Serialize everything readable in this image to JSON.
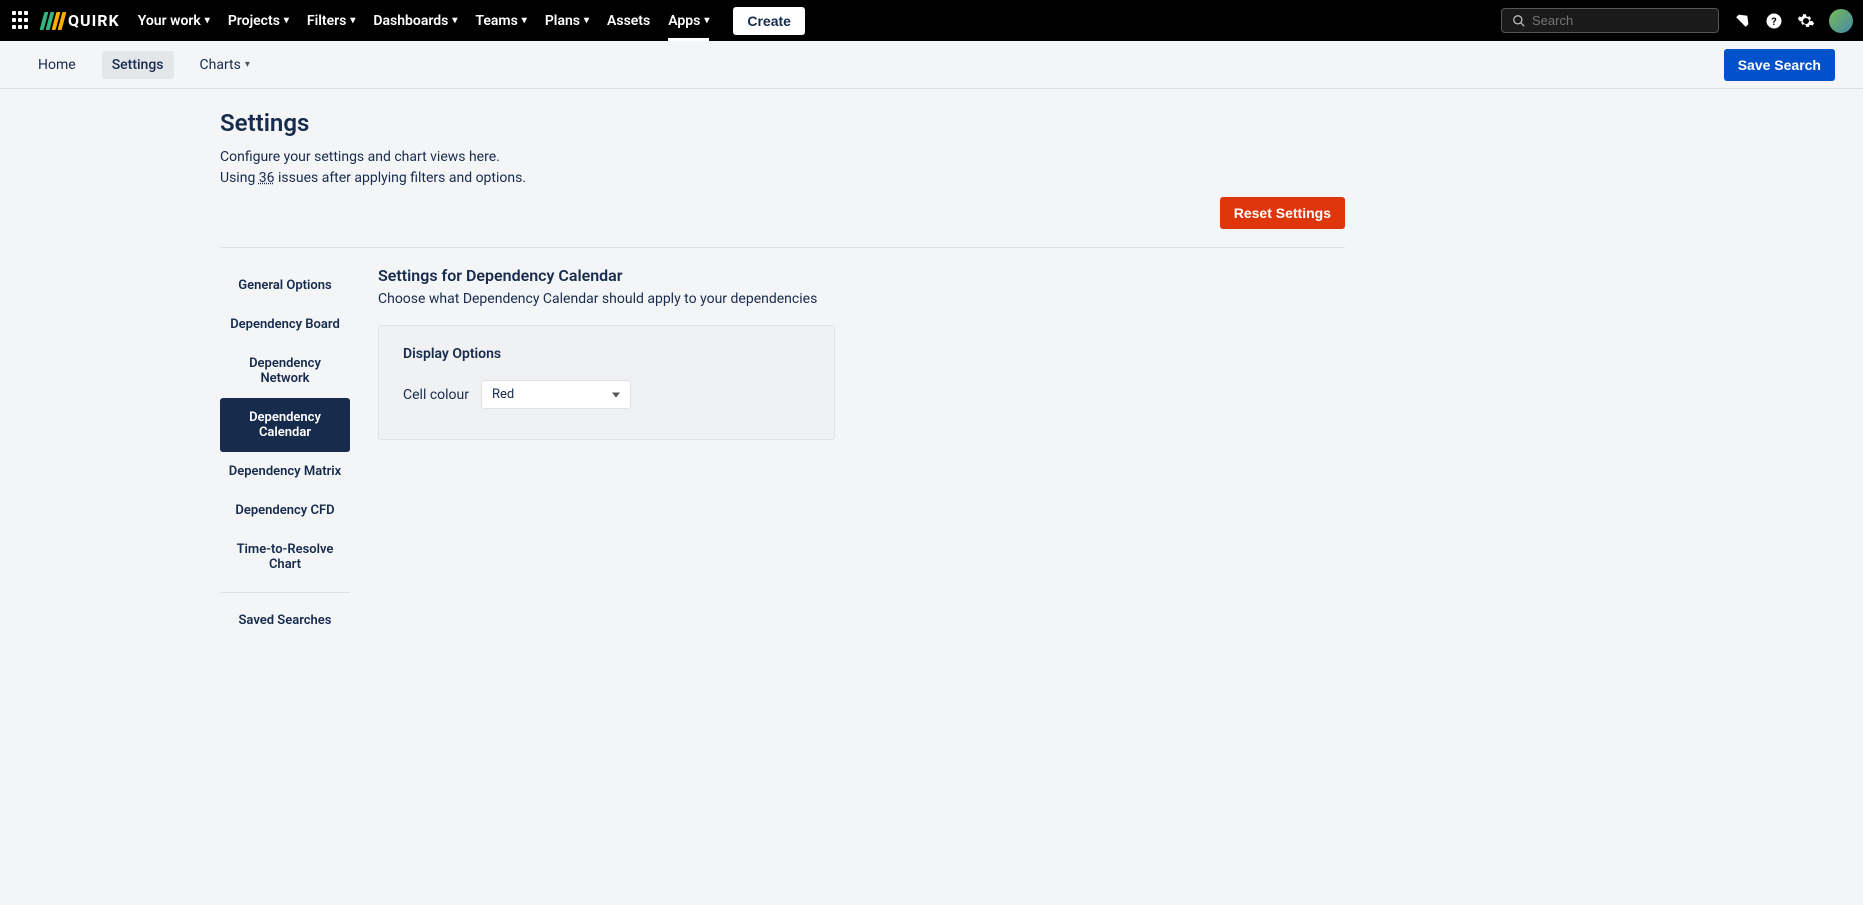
{
  "topnav": {
    "logo_text": "QUIRK",
    "items": [
      {
        "label": "Your work",
        "dropdown": true
      },
      {
        "label": "Projects",
        "dropdown": true
      },
      {
        "label": "Filters",
        "dropdown": true
      },
      {
        "label": "Dashboards",
        "dropdown": true
      },
      {
        "label": "Teams",
        "dropdown": true
      },
      {
        "label": "Plans",
        "dropdown": true
      },
      {
        "label": "Assets",
        "dropdown": false
      },
      {
        "label": "Apps",
        "dropdown": true,
        "active": true
      }
    ],
    "create_label": "Create",
    "search_placeholder": "Search"
  },
  "subnav": {
    "items": [
      {
        "label": "Home"
      },
      {
        "label": "Settings",
        "active": true
      },
      {
        "label": "Charts",
        "dropdown": true
      }
    ],
    "save_search_label": "Save Search"
  },
  "page": {
    "title": "Settings",
    "subtitle1": "Configure your settings and chart views here.",
    "subtitle2_prefix": "Using ",
    "issue_count": "36",
    "subtitle2_suffix": " issues after applying filters and options.",
    "reset_label": "Reset Settings"
  },
  "side_tabs": [
    {
      "label": "General Options"
    },
    {
      "label": "Dependency Board"
    },
    {
      "label": "Dependency Network"
    },
    {
      "label": "Dependency Calendar",
      "active": true
    },
    {
      "label": "Dependency Matrix"
    },
    {
      "label": "Dependency CFD"
    },
    {
      "label": "Time-to-Resolve Chart"
    }
  ],
  "side_tabs_secondary": [
    {
      "label": "Saved Searches"
    }
  ],
  "panel": {
    "heading": "Settings for Dependency Calendar",
    "sub": "Choose what Dependency Calendar should apply to your dependencies",
    "card_heading": "Display Options",
    "cell_colour_label": "Cell colour",
    "cell_colour_value": "Red"
  }
}
